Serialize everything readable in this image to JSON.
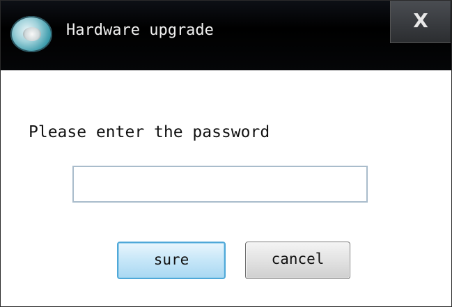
{
  "window": {
    "title": "Hardware upgrade",
    "close_label": "X"
  },
  "dialog": {
    "prompt": "Please enter the password",
    "password": {
      "value": "",
      "placeholder": ""
    },
    "buttons": {
      "sure": "sure",
      "cancel": "cancel"
    }
  },
  "icons": {
    "app": "hardware-disc-icon",
    "close": "close-icon"
  },
  "colors": {
    "titlebar": "#000000",
    "focus_button_border": "#4fa8d8"
  }
}
